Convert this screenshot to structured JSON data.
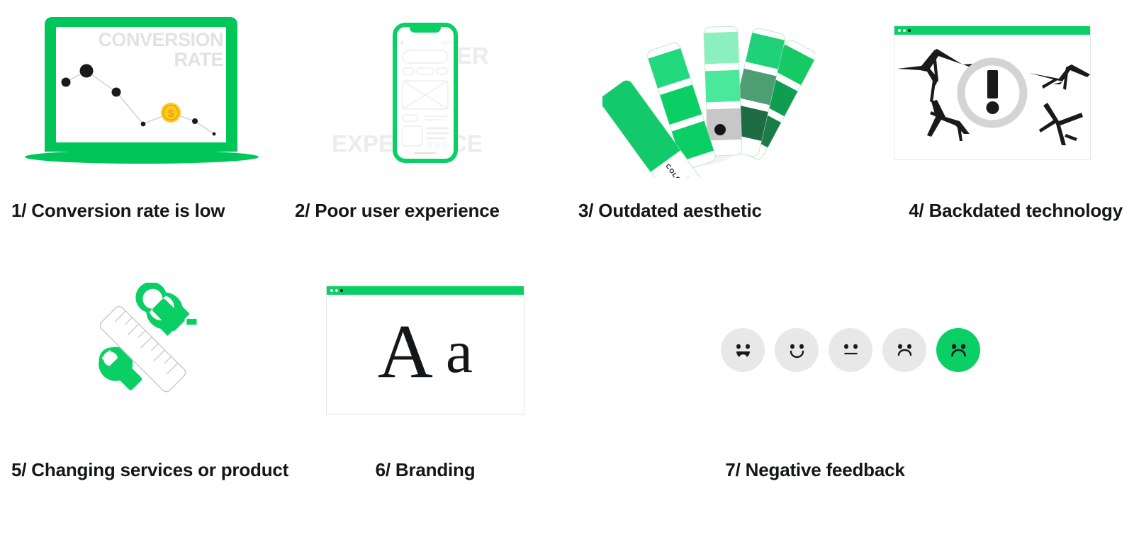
{
  "theme": {
    "accent_green": "#0ACF64",
    "laptop_green": "#00C65A",
    "coin_gold": "#FFC820",
    "ink": "#14171a",
    "face_gray": "#e8e8e8",
    "watermark_gray": "#e2e2e2",
    "background": "#ffffff"
  },
  "items": [
    {
      "number": "1/",
      "caption": "1/ Conversion rate is low",
      "icon": "laptop-declining-chart",
      "watermark": "CONVERSION RATE",
      "watermark_lines": [
        "CONVERSION",
        "RATE"
      ],
      "coin_symbol": "$"
    },
    {
      "number": "2/",
      "caption": "2/ Poor user experience",
      "icon": "smartphone-wireframe",
      "watermark": "USER EXPERIENCE",
      "watermark_lines": [
        "USER",
        "EXPERIENCE"
      ]
    },
    {
      "number": "3/",
      "caption": "3/ Outdated aesthetic",
      "icon": "color-swatch-fan",
      "swatch_label": "COLOR"
    },
    {
      "number": "4/",
      "caption": "4/ Backdated technology",
      "icon": "broken-browser-window-warning"
    },
    {
      "number": "5/",
      "caption": "5/ Changing services or product",
      "icon": "ruler-and-wrench"
    },
    {
      "number": "6/",
      "caption": "6/ Branding",
      "icon": "typography-browser-window",
      "glyph_upper": "A",
      "glyph_lower": "a"
    },
    {
      "number": "7/",
      "caption": "7/ Negative feedback",
      "icon": "emoji-rating-scale",
      "faces": [
        {
          "name": "very-happy",
          "selected": false
        },
        {
          "name": "happy",
          "selected": false
        },
        {
          "name": "neutral",
          "selected": false
        },
        {
          "name": "sad",
          "selected": false
        },
        {
          "name": "very-sad",
          "selected": true
        }
      ]
    }
  ],
  "chart_data": {
    "type": "line",
    "title": "CONVERSION RATE",
    "x": [
      0,
      1,
      2,
      3,
      4,
      5,
      6,
      7
    ],
    "values": [
      62,
      78,
      52,
      20,
      26,
      42,
      34,
      14
    ],
    "xlabel": "",
    "ylabel": "",
    "ylim": [
      0,
      100
    ],
    "grid": false,
    "trend": "declining",
    "marker_sizes": [
      8,
      12,
      8,
      4,
      4,
      14,
      5,
      3
    ],
    "highlight_point_index": 5,
    "highlight_marker": "coin-dollar",
    "line_color": "#cccccc",
    "marker_color": "#1a1a1a"
  }
}
